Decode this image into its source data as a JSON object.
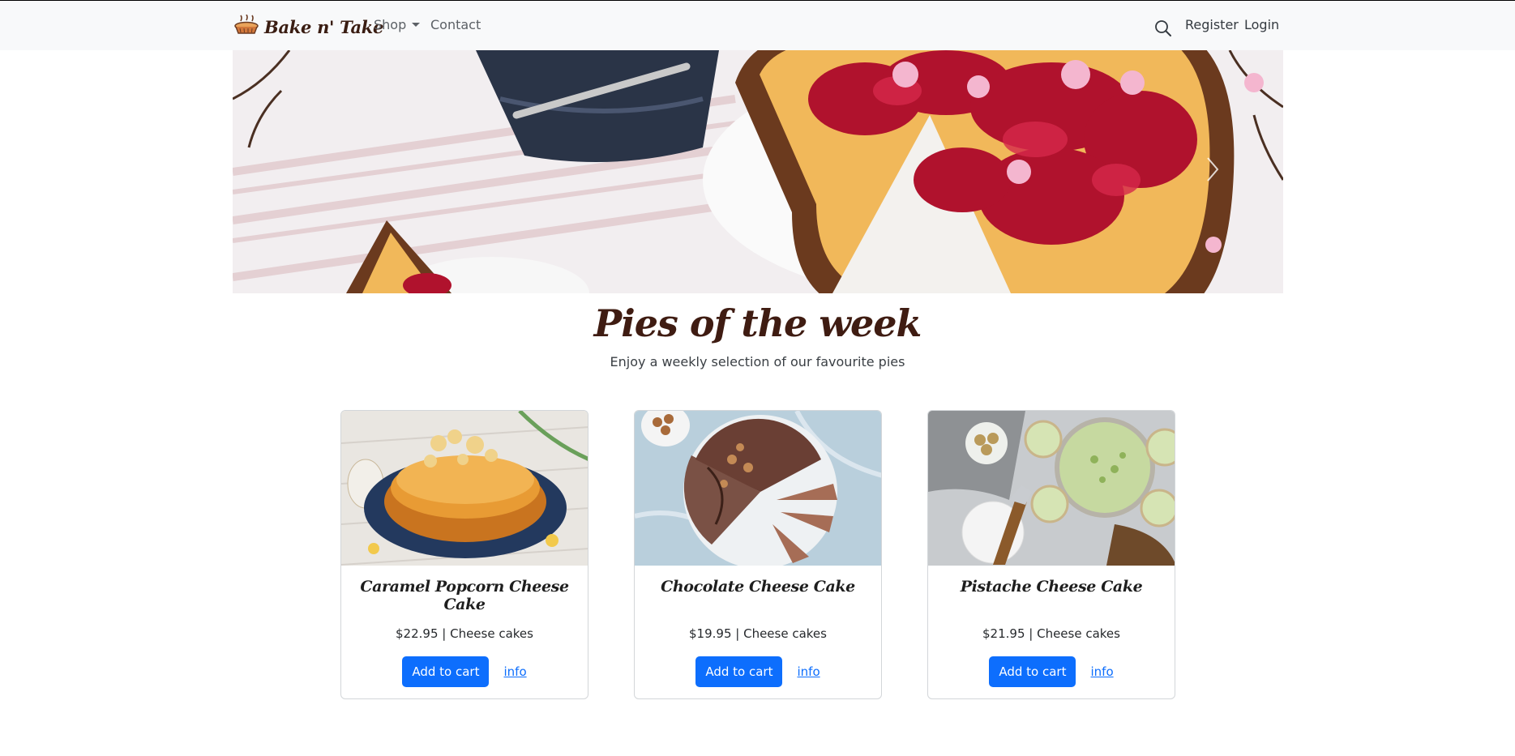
{
  "navbar": {
    "brand": "Bake n' Take",
    "shop_label": "Shop",
    "contact_label": "Contact",
    "register_label": "Register",
    "login_label": "Login"
  },
  "hero": {
    "image": "cheesecake-with-strawberry-topping"
  },
  "section": {
    "title": "Pies of the week",
    "subtitle": "Enjoy a weekly selection of our favourite pies"
  },
  "cards": [
    {
      "name": "Caramel Popcorn Cheese Cake",
      "meta": "$22.95 | Cheese cakes",
      "cart_label": "Add to cart",
      "info_label": "info"
    },
    {
      "name": "Chocolate Cheese Cake",
      "meta": "$19.95 | Cheese cakes",
      "cart_label": "Add to cart",
      "info_label": "info"
    },
    {
      "name": "Pistache Cheese Cake",
      "meta": "$21.95 | Cheese cakes",
      "cart_label": "Add to cart",
      "info_label": "info"
    }
  ],
  "colors": {
    "primary": "#0d6efd",
    "title": "#3f1c12",
    "navbar_bg": "#f8f9fa"
  }
}
